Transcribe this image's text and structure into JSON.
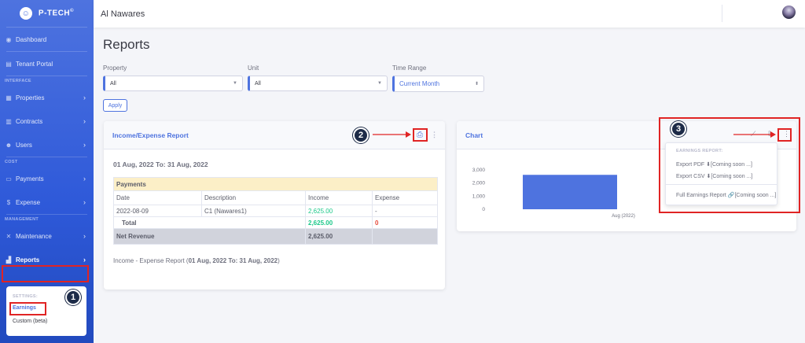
{
  "brand": {
    "name": "P-TECH",
    "mark": "©"
  },
  "sidebar": {
    "items": [
      {
        "label": "Dashboard"
      },
      {
        "label": "Tenant Portal"
      },
      {
        "heading": "INTERFACE"
      },
      {
        "label": "Properties"
      },
      {
        "label": "Contracts"
      },
      {
        "label": "Users"
      },
      {
        "heading": "COST"
      },
      {
        "label": "Payments"
      },
      {
        "label": "Expense"
      },
      {
        "heading": "MANAGEMENT"
      },
      {
        "label": "Maintenance"
      },
      {
        "label": "Reports"
      }
    ],
    "submenu": {
      "heading": "SETTINGS:",
      "items": [
        "Earnings",
        "Custom (beta)"
      ]
    }
  },
  "topbar": {
    "title": "Al Nawares"
  },
  "page": {
    "title": "Reports"
  },
  "filters": {
    "property_label": "Property",
    "property_value": "All",
    "unit_label": "Unit",
    "unit_value": "All",
    "range_label": "Time Range",
    "range_value": "Current Month",
    "apply": "Apply"
  },
  "report": {
    "title": "Income/Expense Report",
    "period_prefix": "01 Aug, 2022 To: 31 Aug, 2022",
    "section": "Payments",
    "columns": [
      "Date",
      "Description",
      "Income",
      "Expense"
    ],
    "row": {
      "date": "2022-08-09",
      "description": "C1 (Nawares1)",
      "income": "2,625.00",
      "expense": "-"
    },
    "total_label": "Total",
    "total_income": "2,625.00",
    "total_expense": "0",
    "net_label": "Net Revenue",
    "net_value": "2,625.00",
    "footer_start": "Income - Expense Report (",
    "footer_bold": "01 Aug, 2022 To: 31 Aug, 2022",
    "footer_end": ")"
  },
  "chart_card": {
    "title": "Chart",
    "menu": {
      "heading": "EARNINGS REPORT:",
      "export_pdf": "Export PDF",
      "export_pdf_note": "[Coming soon ...]",
      "export_csv": "Export CSV",
      "export_csv_note": "[Coming soon ...]",
      "full": "Full Earnings Report",
      "full_note": "[Coming soon ...]"
    }
  },
  "chart_data": {
    "type": "bar",
    "categories": [
      "Aug (2022)"
    ],
    "values": [
      2625
    ],
    "ylim": [
      0,
      3000
    ],
    "yticks": [
      "3,000",
      "2,000",
      "1,000",
      "0"
    ],
    "color": "#4e73df"
  },
  "callouts": [
    "1",
    "2",
    "3"
  ],
  "colors": {
    "primary": "#4e73df",
    "highlight": "#e02424",
    "callout": "#1d2b48"
  }
}
